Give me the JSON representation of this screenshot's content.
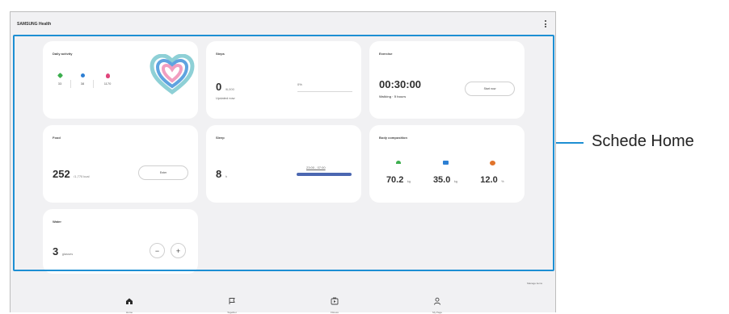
{
  "app": {
    "title": "SAMSUNG Health"
  },
  "cards": {
    "daily_activity": {
      "title": "Daily activity",
      "stats": [
        {
          "value": "33",
          "color": "#3cae4e"
        },
        {
          "value": "38",
          "color": "#2d7fd3"
        },
        {
          "value": "1170",
          "color": "#e0457b"
        }
      ]
    },
    "steps": {
      "title": "Steps",
      "value": "0",
      "unit": "/6,000",
      "sub": "Updated now",
      "bar_label": "0%"
    },
    "exercise": {
      "title": "Exercise",
      "value": "00:30:00",
      "sub": "Walking · 5 hours",
      "button": "Start now"
    },
    "food": {
      "title": "Food",
      "value": "252",
      "unit": "/1,770 kcal",
      "button": "Enter"
    },
    "sleep": {
      "title": "Sleep",
      "value": "8",
      "unit": "h",
      "bar_label": "23:00 - 07:00"
    },
    "body_composition": {
      "title": "Body composition",
      "items": [
        {
          "value": "70.2",
          "unit": "kg",
          "color": "#3cae4e"
        },
        {
          "value": "35.0",
          "unit": "kg",
          "color": "#2d7fd3"
        },
        {
          "value": "12.0",
          "unit": "%",
          "color": "#e0732b"
        }
      ]
    },
    "water": {
      "title": "Water",
      "value": "3",
      "unit": "glasses",
      "minus": "−",
      "plus": "+"
    }
  },
  "manage_items": "Manage items",
  "nav": [
    {
      "label": "Home",
      "icon": "home-icon"
    },
    {
      "label": "Together",
      "icon": "flag-icon"
    },
    {
      "label": "Fitness",
      "icon": "fitness-icon"
    },
    {
      "label": "My Page",
      "icon": "person-icon"
    }
  ],
  "callout": {
    "label": "Schede Home",
    "color": "#1d8fd3"
  }
}
